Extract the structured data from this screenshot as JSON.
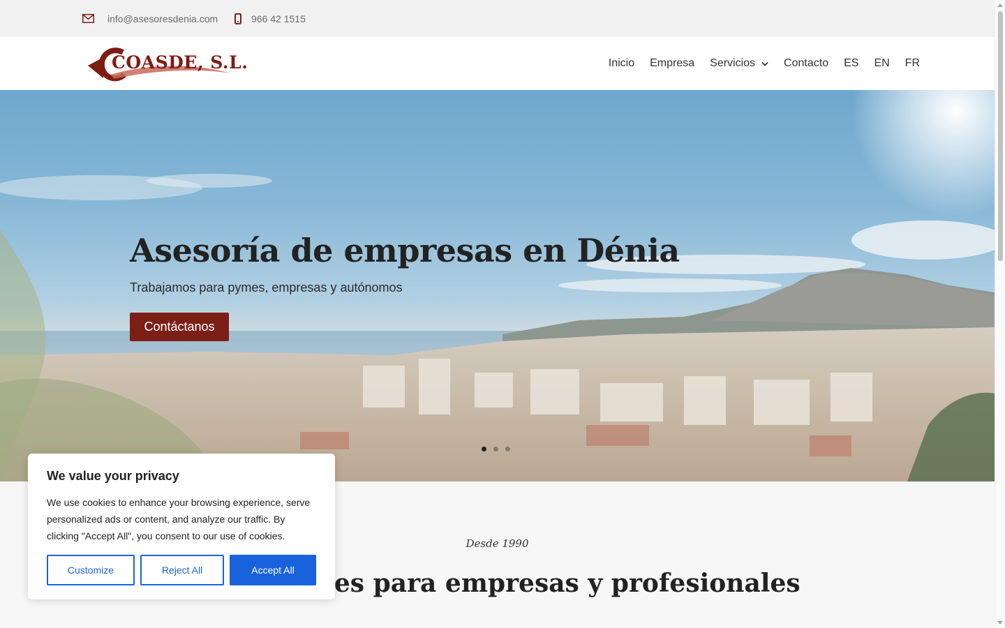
{
  "topbar": {
    "email": "info@asesoresdenia.com",
    "phone": "966 42 1515",
    "email_icon": "envelope-icon",
    "phone_icon": "mobile-phone-icon"
  },
  "header": {
    "logo_text": "COASDE, S.L.",
    "nav": [
      {
        "label": "Inicio"
      },
      {
        "label": "Empresa"
      },
      {
        "label": "Servicios",
        "icon": "chevron-down-icon"
      },
      {
        "label": "Contacto"
      },
      {
        "label": "ES"
      },
      {
        "label": "EN"
      },
      {
        "label": "FR"
      }
    ]
  },
  "hero": {
    "title": "Asesoría de empresas en Dénia",
    "subtitle": "Trabajamos para pymes, empresas y autónomos",
    "cta": "Contáctanos",
    "slides": 3,
    "active_slide": 1
  },
  "section": {
    "kicker": "Desde 1990",
    "title_visible": "integrales para empresas y profesionales"
  },
  "cookie_banner": {
    "title": "We value your privacy",
    "text": "We use cookies to enhance your browsing experience, serve personalized ads or content, and analyze our traffic. By clicking \"Accept All\", you consent to our use of cookies.",
    "customize": "Customize",
    "reject": "Reject All",
    "accept": "Accept All"
  },
  "colors": {
    "brand": "#7b1f17",
    "consent_blue": "#1863dc"
  }
}
